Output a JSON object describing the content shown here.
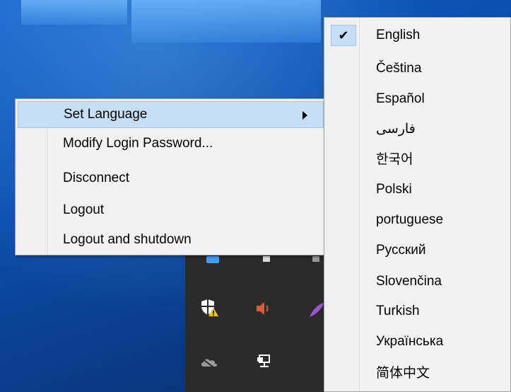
{
  "context_menu": {
    "items": [
      {
        "label": "Set Language"
      },
      {
        "label": "Modify Login Password..."
      },
      {
        "label": "Disconnect"
      },
      {
        "label": "Logout"
      },
      {
        "label": "Logout and shutdown"
      }
    ]
  },
  "language_menu": {
    "check_mark": "✔",
    "items": [
      {
        "label": "English",
        "checked": true
      },
      {
        "label": "Čeština"
      },
      {
        "label": "Español"
      },
      {
        "label": "فارسی"
      },
      {
        "label": "한국어"
      },
      {
        "label": "Polski"
      },
      {
        "label": "portuguese"
      },
      {
        "label": "Русский"
      },
      {
        "label": "Slovenčina"
      },
      {
        "label": "Turkish"
      },
      {
        "label": "Українська"
      },
      {
        "label": "简体中文"
      }
    ]
  },
  "tray_icons": [
    "security-shield-icon",
    "speaker-icon",
    "feather-icon",
    "cloud-offline-icon",
    "network-icon"
  ],
  "colors": {
    "highlight": "#c6def6",
    "menu_bg": "#f2f2f2",
    "tray_bg": "#2b2b2b"
  }
}
